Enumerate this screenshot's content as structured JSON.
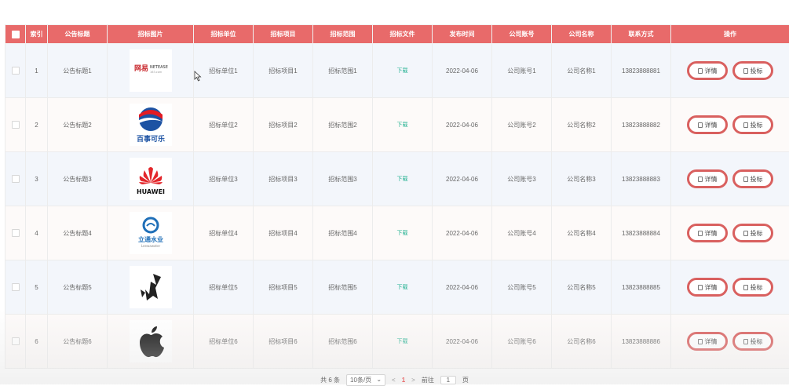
{
  "columns": {
    "select": "",
    "index": "索引",
    "title": "公告标题",
    "image": "招标图片",
    "unit": "招标单位",
    "project": "招标项目",
    "scope": "招标范围",
    "file": "招标文件",
    "time": "发布时间",
    "account": "公司账号",
    "company": "公司名称",
    "contact": "联系方式",
    "actions": "操作"
  },
  "rows": [
    {
      "index": "1",
      "title": "公告标题1",
      "logo": "neteasy-logo",
      "logo_text": "网易 NETEASE",
      "unit": "招标单位1",
      "project": "招标项目1",
      "scope": "招标范围1",
      "file": "下载",
      "time": "2022-04-06",
      "account": "公司账号1",
      "company": "公司名称1",
      "contact": "13823888881",
      "detail": "详情",
      "bid": "投标"
    },
    {
      "index": "2",
      "title": "公告标题2",
      "logo": "pepsi-logo",
      "logo_text": "百事可乐",
      "unit": "招标单位2",
      "project": "招标项目2",
      "scope": "招标范围2",
      "file": "下载",
      "time": "2022-04-06",
      "account": "公司账号2",
      "company": "公司名称2",
      "contact": "13823888882",
      "detail": "详情",
      "bid": "投标"
    },
    {
      "index": "3",
      "title": "公告标题3",
      "logo": "huawei-logo",
      "logo_text": "HUAWEI",
      "unit": "招标单位3",
      "project": "招标项目3",
      "scope": "招标范围3",
      "file": "下载",
      "time": "2022-04-06",
      "account": "公司账号3",
      "company": "公司名称3",
      "contact": "13823888883",
      "detail": "详情",
      "bid": "投标"
    },
    {
      "index": "4",
      "title": "公告标题4",
      "logo": "liwater-logo",
      "logo_text": "立通水业",
      "unit": "招标单位4",
      "project": "招标项目4",
      "scope": "招标范围4",
      "file": "下载",
      "time": "2022-04-06",
      "account": "公司账号4",
      "company": "公司名称4",
      "contact": "13823888884",
      "detail": "详情",
      "bid": "投标"
    },
    {
      "index": "5",
      "title": "公告标题5",
      "logo": "bird-logo",
      "logo_text": "",
      "unit": "招标单位5",
      "project": "招标项目5",
      "scope": "招标范围5",
      "file": "下载",
      "time": "2022-04-06",
      "account": "公司账号5",
      "company": "公司名称5",
      "contact": "13823888885",
      "detail": "详情",
      "bid": "投标"
    },
    {
      "index": "6",
      "title": "公告标题6",
      "logo": "apple-logo",
      "logo_text": "",
      "unit": "招标单位6",
      "project": "招标项目6",
      "scope": "招标范围6",
      "file": "下载",
      "time": "2022-04-06",
      "account": "公司账号6",
      "company": "公司名称6",
      "contact": "13823888886",
      "detail": "详情",
      "bid": "投标"
    }
  ],
  "pagination": {
    "total": "共 6 条",
    "page_size": "10条/页",
    "prev": "<",
    "current": "1",
    "next": ">",
    "goto_label": "前往",
    "goto_value": "1",
    "page_suffix": "页"
  },
  "colors": {
    "header_bg": "#e86a6a",
    "button_border": "#d9605f",
    "download_link": "#20b090"
  }
}
